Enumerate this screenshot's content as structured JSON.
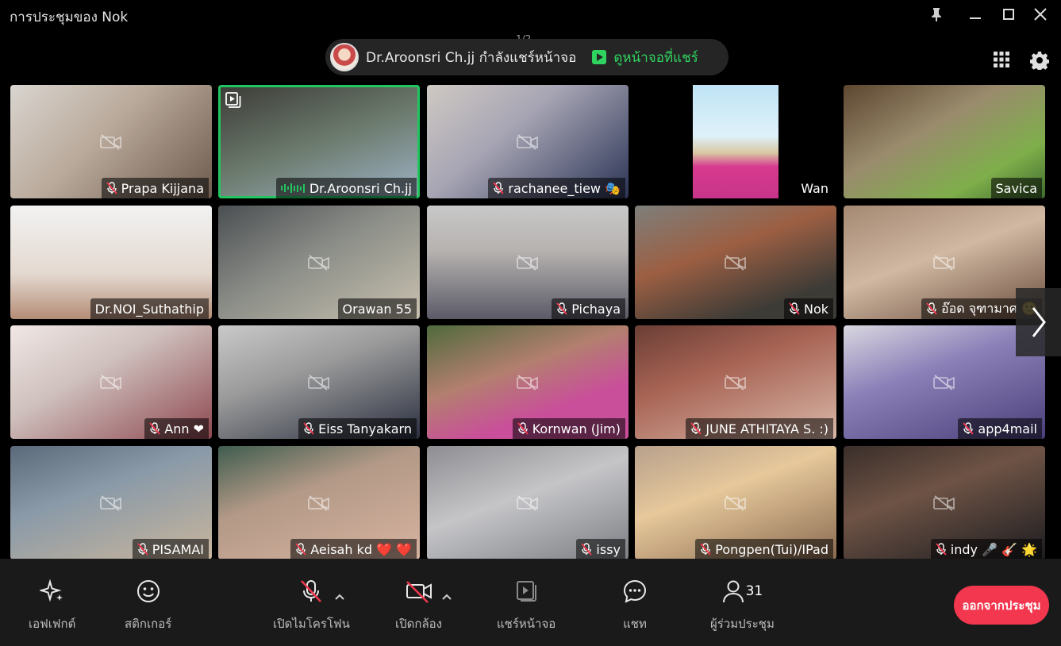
{
  "window": {
    "title": "การประชุมของ Nok",
    "page_indicator": "1/2"
  },
  "share_banner": {
    "text": "Dr.Aroonsri Ch.jj กำลังแชร์หน้าจอ",
    "view_label": "ดูหน้าจอที่แชร์"
  },
  "colors": {
    "accent_green": "#22c55e",
    "leave_red": "#f2374e",
    "bar_bg": "#1a1a1a"
  },
  "participants": [
    {
      "name": "Prapa Kijjana",
      "muted": true,
      "cam_off": true
    },
    {
      "name": "Dr.Aroonsri Ch.jj",
      "muted": false,
      "cam_off": false,
      "speaking": true,
      "sharing": true
    },
    {
      "name": "rachanee_tiew 🎭",
      "muted": true,
      "cam_off": true
    },
    {
      "name": "Wan",
      "muted": false,
      "cam_off": false
    },
    {
      "name": "Savica",
      "muted": false,
      "cam_off": false
    },
    {
      "name": "Dr.NOI_Suthathip",
      "muted": false,
      "cam_off": false
    },
    {
      "name": "Orawan 55",
      "muted": false,
      "cam_off": true
    },
    {
      "name": "Pichaya",
      "muted": true,
      "cam_off": true
    },
    {
      "name": "Nok",
      "muted": true,
      "cam_off": true
    },
    {
      "name": "อ๊อด จุฑามาศ 🙂",
      "muted": true,
      "cam_off": true
    },
    {
      "name": "Ann ❤",
      "muted": true,
      "cam_off": true
    },
    {
      "name": "Eiss Tanyakarn",
      "muted": true,
      "cam_off": true
    },
    {
      "name": "Kornwan (Jim)",
      "muted": true,
      "cam_off": true
    },
    {
      "name": "JUNE ATHITAYA S. :)",
      "muted": true,
      "cam_off": true
    },
    {
      "name": "app4mail",
      "muted": true,
      "cam_off": true
    },
    {
      "name": "PISAMAI",
      "muted": true,
      "cam_off": true
    },
    {
      "name": "Aeisah kd ❤️ ❤️",
      "muted": true,
      "cam_off": true
    },
    {
      "name": "issy",
      "muted": true,
      "cam_off": true
    },
    {
      "name": "Pongpen(Tui)/IPad",
      "muted": true,
      "cam_off": true
    },
    {
      "name": "indy 🎤 🎸 🌟",
      "muted": true,
      "cam_off": true
    }
  ],
  "toolbar": {
    "effects_label": "เอฟเฟกต์",
    "stickers_label": "สติกเกอร์",
    "mic_label": "เปิดไมโครโฟน",
    "camera_label": "เปิดกล้อง",
    "share_label": "แชร์หน้าจอ",
    "chat_label": "แชท",
    "participants_label": "ผู้ร่วมประชุม",
    "participants_count": "31",
    "leave_label": "ออกจากประชุม"
  }
}
